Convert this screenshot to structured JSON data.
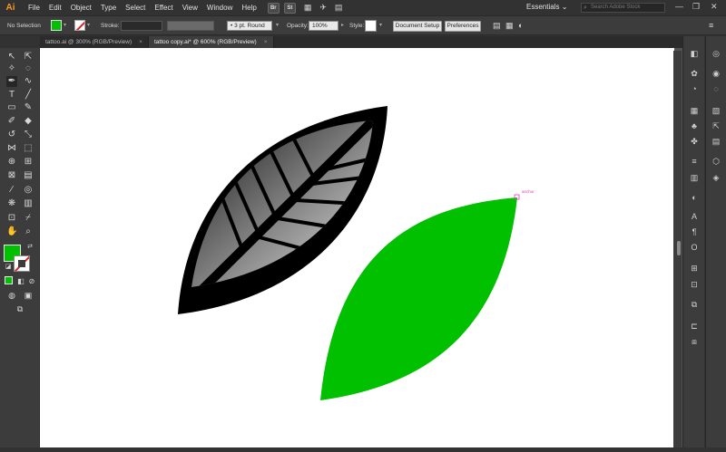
{
  "app": {
    "logo_text": "Ai",
    "accent_color": "#f49a23"
  },
  "menu": {
    "items": [
      "File",
      "Edit",
      "Object",
      "Type",
      "Select",
      "Effect",
      "View",
      "Window",
      "Help"
    ]
  },
  "app_switchers": [
    "Br",
    "St"
  ],
  "workspace": {
    "label": "Essentials"
  },
  "search": {
    "placeholder": "Search Adobe Stock"
  },
  "window_controls": {
    "minimize": "—",
    "maximize": "❐",
    "close": "✕"
  },
  "control_bar": {
    "selection_label": "No Selection",
    "stroke_label": "Stroke:",
    "brush_value": "3 pt. Round",
    "opacity_label": "Opacity:",
    "opacity_value": "100%",
    "style_label": "Style:",
    "document_setup": "Document Setup",
    "preferences": "Preferences"
  },
  "tabs": [
    {
      "label": "tattoo.ai @ 300% (RGB/Preview)",
      "active": false
    },
    {
      "label": "tattoo copy.ai* @ 600% (RGB/Preview)",
      "active": true
    }
  ],
  "canvas": {
    "anchor_label": "anchor",
    "fill_color": "#00c000"
  },
  "icons": {
    "left_tools": [
      "selection-tool-icon",
      "direct-selection-tool-icon",
      "magic-wand-icon",
      "lasso-icon",
      "pen-tool-icon",
      "curvature-tool-icon",
      "type-tool-icon",
      "line-tool-icon",
      "rectangle-tool-icon",
      "paintbrush-icon",
      "shaper-tool-icon",
      "eraser-icon",
      "rotate-tool-icon",
      "scale-tool-icon",
      "width-tool-icon",
      "free-transform-icon",
      "shape-builder-icon",
      "perspective-grid-icon",
      "mesh-tool-icon",
      "gradient-tool-icon",
      "eyedropper-icon",
      "blend-tool-icon",
      "symbol-sprayer-icon",
      "column-graph-icon",
      "artboard-tool-icon",
      "slice-tool-icon",
      "hand-tool-icon",
      "zoom-tool-icon"
    ],
    "right_panels": [
      "properties-icon",
      "libraries-icon",
      "color-icon",
      "color-guide-icon",
      "swatches-icon",
      "brushes-icon",
      "symbols-icon",
      "graphic-styles-icon",
      "appearance-icon",
      "layers-icon",
      "character-icon",
      "paragraph-icon",
      "opentype-icon",
      "align-icon",
      "transform-icon",
      "pathfinder-icon",
      "transparency-icon",
      "stroke-icon",
      "gradient-icon",
      "links-icon",
      "artboards-icon",
      "asset-export-icon"
    ]
  }
}
